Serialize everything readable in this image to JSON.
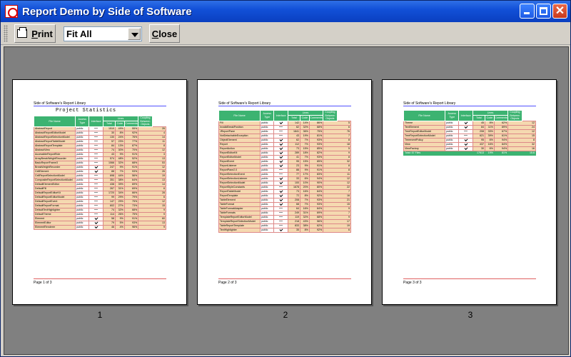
{
  "window": {
    "title": "Report Demo by Side of Software",
    "controls": {
      "minimize": "minimize-icon",
      "maximize": "maximize-icon",
      "close": "close-icon"
    }
  },
  "toolbar": {
    "print_label": "Print",
    "print_mnemonic": "P",
    "print_rest": "rint",
    "fit_value": "Fit All",
    "close_label": "Close",
    "close_mnemonic": "C",
    "close_rest": "lose"
  },
  "report": {
    "library_title": "Side of Software's Report Library",
    "stats_title": "Project Statistics",
    "headers": {
      "file_name": "File Name",
      "access_type": "Access Type",
      "interface": "Interface",
      "lines": "Lines",
      "total": "Total",
      "code": "Code",
      "comments": "Comments",
      "coupling": "Coupling Between Objects"
    }
  },
  "pages": [
    {
      "label": "1",
      "footer": "Page 1 of 3",
      "rows": [
        [
          "AbstractReport",
          "public",
          "",
          "1510",
          "49%",
          "55%",
          "26"
        ],
        [
          "AbstractReportEditorModel",
          "public",
          "",
          "30",
          "8%",
          "92%",
          "4"
        ],
        [
          "AbstractReportSelectionModel",
          "public",
          "",
          "130",
          "24%",
          "76%",
          "14"
        ],
        [
          "AbstractReportTableModel",
          "public",
          "",
          "57",
          "23%",
          "77%",
          "11"
        ],
        [
          "AbstractReportTemplate",
          "public",
          "",
          "84",
          "13%",
          "87%",
          "8"
        ],
        [
          "AbstractView",
          "public",
          "",
          "74",
          "30%",
          "70%",
          "12"
        ],
        [
          "AccessibleReportRole",
          "public",
          "",
          "43",
          "9%",
          "91%",
          "3"
        ],
        [
          "ArrayBreakWeightRecorder",
          "public",
          "",
          "574",
          "48%",
          "52%",
          "13"
        ],
        [
          "BasicReportFrame3",
          "public",
          "",
          "1066",
          "32%",
          "68%",
          "53"
        ],
        [
          "BreakWeightRecorder",
          "public",
          "y",
          "247",
          "9%",
          "91%",
          "12"
        ],
        [
          "CellElement",
          "public",
          "y",
          "88",
          "7%",
          "93%",
          "26"
        ],
        [
          "CellReportSelectionModel",
          "public",
          "",
          "698",
          "44%",
          "56%",
          "19"
        ],
        [
          "CompositeReportSelectionModel",
          "public",
          "",
          "351",
          "38%",
          "64%",
          "13"
        ],
        [
          "DefaultElementEditor",
          "public",
          "",
          "438",
          "39%",
          "69%",
          "14"
        ],
        [
          "DefaultFill",
          "public",
          "",
          "267",
          "31%",
          "69%",
          "6"
        ],
        [
          "DefaultReportEditorKit",
          "public",
          "",
          "1720",
          "34%",
          "66%",
          "28"
        ],
        [
          "DefaultReportEditorModel",
          "public",
          "",
          "99",
          "29%",
          "79%",
          "6"
        ],
        [
          "DefaultReportEvent",
          "public",
          "",
          "147",
          "29%",
          "75%",
          "12"
        ],
        [
          "DefaultReportFormat",
          "public",
          "",
          "602",
          "27%",
          "73%",
          "15"
        ],
        [
          "DefaultTextHighlighter",
          "public",
          "",
          "74",
          "32%",
          "68%",
          "9"
        ],
        [
          "DefaultTheme",
          "public",
          "",
          "114",
          "26%",
          "75%",
          "9"
        ],
        [
          "Element",
          "public",
          "y",
          "58",
          "9%",
          "91%",
          "60"
        ],
        [
          "ElementEditor",
          "public",
          "y",
          "79",
          "5%",
          "93%",
          "13"
        ],
        [
          "ElementRenderer",
          "public",
          "y",
          "46",
          "4%",
          "96%",
          "9"
        ]
      ]
    },
    {
      "label": "2",
      "footer": "Page 2 of 3",
      "rows": [
        [
          "Fill",
          "public",
          "y",
          "142",
          "14%",
          "86%",
          "5"
        ],
        [
          "InvalidBreakPosition",
          "public",
          "",
          "62",
          "32%",
          "68%",
          "6"
        ],
        [
          "JReportPane",
          "public",
          "",
          "1841",
          "36%",
          "75%",
          "76"
        ],
        [
          "NotDetachableException",
          "public",
          "",
          "43",
          "19%",
          "81%",
          "7"
        ],
        [
          "ObjectElement",
          "public",
          "y",
          "62",
          "7%",
          "93%",
          "8"
        ],
        [
          "Report",
          "public",
          "y",
          "112",
          "7%",
          "93%",
          "18"
        ],
        [
          "ReportAction",
          "public",
          "y",
          "73",
          "15%",
          "85%",
          "5"
        ],
        [
          "ReportEditorKit",
          "public",
          "y",
          "289",
          "18%",
          "82%",
          "9"
        ],
        [
          "ReportEditorModel",
          "public",
          "y",
          "41",
          "7%",
          "93%",
          "8"
        ],
        [
          "ReportEvent",
          "public",
          "y",
          "95",
          "15%",
          "85%",
          "32"
        ],
        [
          "ReportListener",
          "public",
          "y",
          "23",
          "9%",
          "91%",
          "8"
        ],
        [
          "ReportPane2.0",
          "public",
          "",
          "88",
          "9%",
          "91%",
          "8"
        ],
        [
          "ReportSelectionEvent",
          "public",
          "",
          "77",
          "17%",
          "83%",
          "11"
        ],
        [
          "ReportSelectionListener",
          "public",
          "y",
          "33",
          "6%",
          "94%",
          "12"
        ],
        [
          "ReportSelectionModel",
          "public",
          "y",
          "100",
          "10%",
          "90%",
          "12"
        ],
        [
          "ReportStyleConstants",
          "public",
          "",
          "1678",
          "20%",
          "80%",
          "22"
        ],
        [
          "ReportTableModel",
          "public",
          "y",
          "73",
          "16%",
          "84%",
          "7"
        ],
        [
          "ReportTemplate",
          "public",
          "y",
          "72",
          "8%",
          "92%",
          "16"
        ],
        [
          "TableElement",
          "public",
          "y",
          "208",
          "7%",
          "93%",
          "21"
        ],
        [
          "TableFormat",
          "public",
          "y",
          "68",
          "7%",
          "93%",
          "15"
        ],
        [
          "TableFormatAdapter",
          "public",
          "",
          "64",
          "16%",
          "84%",
          "9"
        ],
        [
          "TableFormats",
          "public",
          "",
          "249",
          "31%",
          "69%",
          "7"
        ],
        [
          "TemplateReportEditorModel",
          "public",
          "",
          "119",
          "32%",
          "68%",
          "9"
        ],
        [
          "TemplateReportSelectionModel",
          "public",
          "",
          "218",
          "43%",
          "56%",
          "17"
        ],
        [
          "TableReportTemplate",
          "public",
          "",
          "833",
          "38%",
          "62%",
          "19"
        ],
        [
          "TextHighlighter",
          "public",
          "y",
          "35",
          "8%",
          "92%",
          "6"
        ]
      ]
    },
    {
      "label": "3",
      "footer": "Page 3 of 3",
      "rows": [
        [
          "Theme",
          "public",
          "y",
          "45",
          "8%",
          "62%",
          "12"
        ],
        [
          "TextElement",
          "public",
          "y",
          "84",
          "11%",
          "89%",
          "24"
        ],
        [
          "TreeReportEditorModel",
          "public",
          "",
          "208",
          "33%",
          "67%",
          "12"
        ],
        [
          "TreeReportSelectionModel",
          "public",
          "",
          "621",
          "39%",
          "61%",
          "15"
        ],
        [
          "TreeeventPolicy",
          "public",
          "y",
          "95",
          "6%",
          "94%",
          "8"
        ],
        [
          "View",
          "public",
          "y",
          "437",
          "16%",
          "84%",
          "32"
        ],
        [
          "ViewFactory",
          "public",
          "y",
          "30",
          "6%",
          "94%",
          "16"
        ]
      ],
      "total": [
        "Total: 57 Files",
        "",
        "",
        "17613",
        "19%",
        "81%",
        "15.6"
      ]
    }
  ]
}
